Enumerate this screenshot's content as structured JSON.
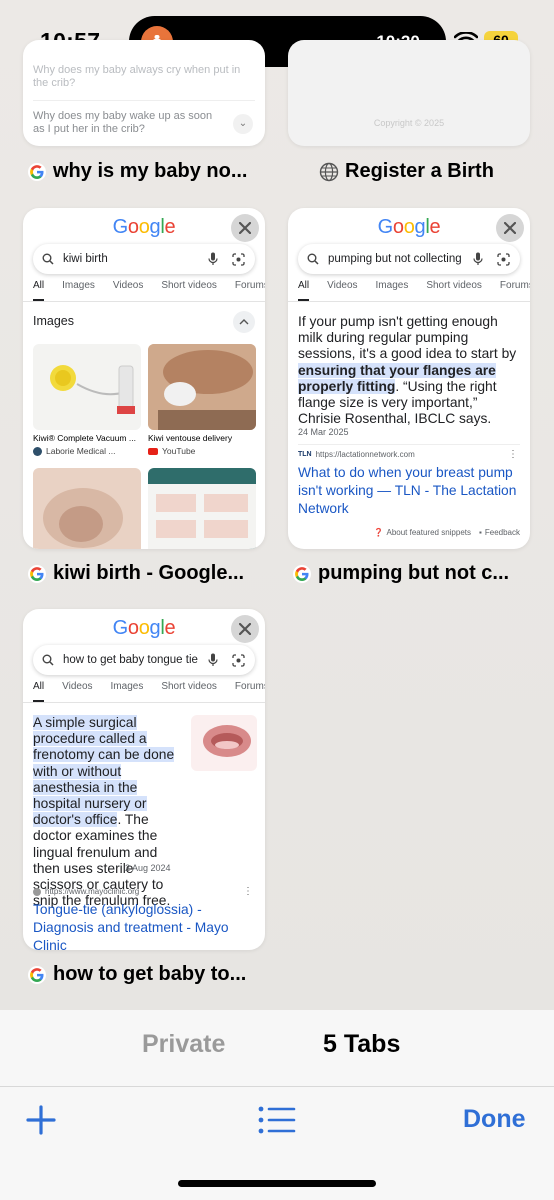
{
  "status": {
    "time": "10:57",
    "island_time": "10:20...",
    "battery": "60"
  },
  "top_tabs": [
    {
      "title": "why is my baby no...",
      "icon": "google-icon",
      "preview": {
        "q1": "Why does my baby always cry when put in the crib?",
        "q2": "Why does my baby wake up as soon as I put her in the crib?"
      }
    },
    {
      "title": "Register a Birth",
      "icon": "globe-icon",
      "preview": {
        "footer": "Copyright © 2025"
      }
    }
  ],
  "tabs": [
    {
      "title": "kiwi birth - Google...",
      "query": "kiwi birth",
      "gtabs": [
        "All",
        "Images",
        "Videos",
        "Short videos",
        "Forums"
      ],
      "section": "Images",
      "images": [
        {
          "caption": "Kiwi® Complete Vacuum ...",
          "source": "Laborie Medical ..."
        },
        {
          "caption": "Kiwi ventouse delivery",
          "source": "YouTube"
        }
      ]
    },
    {
      "title": "pumping but not c...",
      "query": "pumping but not collecting",
      "gtabs": [
        "All",
        "Videos",
        "Images",
        "Short videos",
        "Forums"
      ],
      "snippet_pre": "If your pump isn't getting enough milk during regular pumping sessions, it's a good idea to start by ",
      "snippet_hl": "ensuring that your flanges are properly fitting",
      "snippet_post": ". “Using the right flange size is very important,” Chrisie Rosenthal, IBCLC says.",
      "date": "24 Mar 2025",
      "url": "https://lactationnetwork.com",
      "link": "What to do when your breast pump isn't working — TLN - The Lactation Network",
      "about": "About featured snippets",
      "feedback": "Feedback"
    },
    {
      "title": "how to get baby to...",
      "query": "how to get baby tongue tie",
      "gtabs": [
        "All",
        "Videos",
        "Images",
        "Short videos",
        "Forums"
      ],
      "snippet_hl": "A simple surgical procedure called a frenotomy can be done with or without anesthesia in the hospital nursery or doctor's office",
      "snippet_post": ". The doctor examines the lingual frenulum and then uses sterile scissors or cautery to snip the frenulum free.",
      "date": "2 Aug 2024",
      "url": "https://www.mayoclinic.org",
      "link": "Tongue-tie (ankyloglossia) - Diagnosis and treatment - Mayo Clinic"
    }
  ],
  "google_logo": "Google",
  "segments": {
    "private": "Private",
    "tabs": "5 Tabs"
  },
  "toolbar": {
    "done": "Done"
  },
  "colors": {
    "accent": "#2f6fd6",
    "highlight": "#d5e2fb",
    "battery": "#f5d33d"
  }
}
